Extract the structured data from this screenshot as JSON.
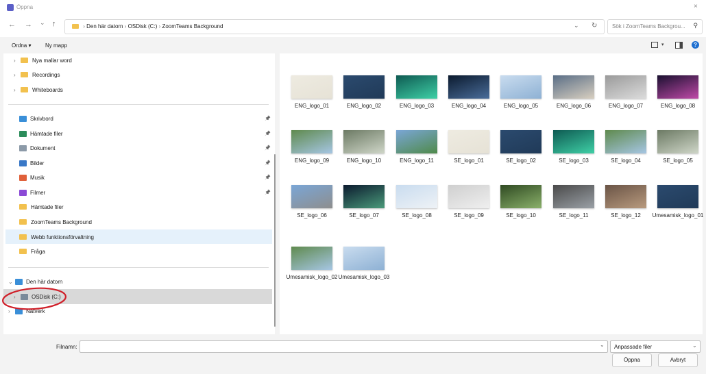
{
  "window": {
    "title": "Öppna",
    "close_glyph": "×"
  },
  "nav": {
    "back": "←",
    "forward": "→",
    "recent": "⌄",
    "up": "↑",
    "refresh": "↻"
  },
  "address": {
    "pc": "Den här datorn",
    "disk": "OSDisk (C:)",
    "folder": "ZoomTeams Background",
    "sep": "›",
    "dropdown": "⌄"
  },
  "search": {
    "placeholder": "Sök i ZoomTeams Backgrou...",
    "icon": "search-icon"
  },
  "toolbar": {
    "organize": "Ordna ▾",
    "new_folder": "Ny mapp"
  },
  "sidebar": {
    "folders_top": [
      {
        "label": "Nya mallar word"
      },
      {
        "label": "Recordings"
      },
      {
        "label": "Whiteboards"
      }
    ],
    "quick": [
      {
        "label": "Skrivbord",
        "icon": "desktop-icon",
        "pinned": true,
        "color": "#3a8fd8"
      },
      {
        "label": "Hämtade filer",
        "icon": "download-icon",
        "pinned": true,
        "color": "#2b8c5a"
      },
      {
        "label": "Dokument",
        "icon": "document-icon",
        "pinned": true,
        "color": "#8c9aa8"
      },
      {
        "label": "Bilder",
        "icon": "pictures-icon",
        "pinned": true,
        "color": "#3978c7"
      },
      {
        "label": "Musik",
        "icon": "music-icon",
        "pinned": true,
        "color": "#e0603a"
      },
      {
        "label": "Filmer",
        "icon": "videos-icon",
        "pinned": true,
        "color": "#8b4ad6"
      },
      {
        "label": "Hämtade filer",
        "icon": "folder-icon",
        "pinned": false,
        "color": "#f2c14e"
      },
      {
        "label": "ZoomTeams Background",
        "icon": "folder-icon",
        "pinned": false,
        "color": "#f2c14e"
      },
      {
        "label": "Webb funktionsförvaltning",
        "icon": "folder-icon",
        "pinned": false,
        "color": "#f2c14e"
      },
      {
        "label": "Fråga",
        "icon": "shared-folder-icon",
        "pinned": false,
        "color": "#f2c14e"
      }
    ],
    "pc": {
      "label": "Den här datorn"
    },
    "disk": {
      "label": "OSDisk (C:)"
    },
    "network": {
      "label": "Nätverk"
    }
  },
  "files": [
    {
      "name": "ENG_logo_01",
      "colors": [
        "#eeebe1",
        "#e6e2d6"
      ]
    },
    {
      "name": "ENG_logo_02",
      "colors": [
        "#2b4a6e",
        "#203a58"
      ]
    },
    {
      "name": "ENG_logo_03",
      "colors": [
        "#0e5a52",
        "#3fd0a6"
      ]
    },
    {
      "name": "ENG_logo_04",
      "colors": [
        "#0b1a2e",
        "#4a6d9a"
      ]
    },
    {
      "name": "ENG_logo_05",
      "colors": [
        "#c9dcef",
        "#8eb1d4"
      ]
    },
    {
      "name": "ENG_logo_06",
      "colors": [
        "#5a6e86",
        "#d8cfc0"
      ]
    },
    {
      "name": "ENG_logo_07",
      "colors": [
        "#9a9a9a",
        "#dcdcdc"
      ]
    },
    {
      "name": "ENG_logo_08",
      "colors": [
        "#1a1030",
        "#c04aa8"
      ]
    },
    {
      "name": "ENG_logo_09",
      "colors": [
        "#5f8a4e",
        "#a6c6e4"
      ]
    },
    {
      "name": "ENG_logo_10",
      "colors": [
        "#6c7a64",
        "#cfd6c8"
      ]
    },
    {
      "name": "ENG_logo_11",
      "colors": [
        "#7aa6d6",
        "#4f8a4a"
      ]
    },
    {
      "name": "SE_logo_01",
      "colors": [
        "#eeebe1",
        "#e6e2d6"
      ]
    },
    {
      "name": "SE_logo_02",
      "colors": [
        "#2b4a6e",
        "#203a58"
      ]
    },
    {
      "name": "SE_logo_03",
      "colors": [
        "#0e5a52",
        "#3fd0a6"
      ]
    },
    {
      "name": "SE_logo_04",
      "colors": [
        "#5f8a4e",
        "#a6c6e4"
      ]
    },
    {
      "name": "SE_logo_05",
      "colors": [
        "#6c7a64",
        "#cfd6c8"
      ]
    },
    {
      "name": "SE_logo_06",
      "colors": [
        "#7aa6d6",
        "#8e8e8e"
      ]
    },
    {
      "name": "SE_logo_07",
      "colors": [
        "#0b1a2e",
        "#4a9a7a"
      ]
    },
    {
      "name": "SE_logo_08",
      "colors": [
        "#c9dcef",
        "#eef2f6"
      ]
    },
    {
      "name": "SE_logo_09",
      "colors": [
        "#cfcfcf",
        "#efefef"
      ]
    },
    {
      "name": "SE_logo_10",
      "colors": [
        "#2f4a22",
        "#8ab06a"
      ]
    },
    {
      "name": "SE_logo_11",
      "colors": [
        "#4a4a4a",
        "#9aa0a6"
      ]
    },
    {
      "name": "SE_logo_12",
      "colors": [
        "#6a5446",
        "#b89a7e"
      ]
    },
    {
      "name": "Umesamisk_logo_01",
      "colors": [
        "#2b4a6e",
        "#203a58"
      ]
    },
    {
      "name": "Umesamisk_logo_02",
      "colors": [
        "#5f8a4e",
        "#a6c6e4"
      ]
    },
    {
      "name": "Umesamisk_logo_03",
      "colors": [
        "#c9dcef",
        "#8eb1d4"
      ]
    }
  ],
  "footer": {
    "filename_label": "Filnamn:",
    "filename_value": "",
    "filetype": "Anpassade filer",
    "open": "Öppna",
    "cancel": "Avbryt"
  },
  "annotation_color": "#d0202a"
}
